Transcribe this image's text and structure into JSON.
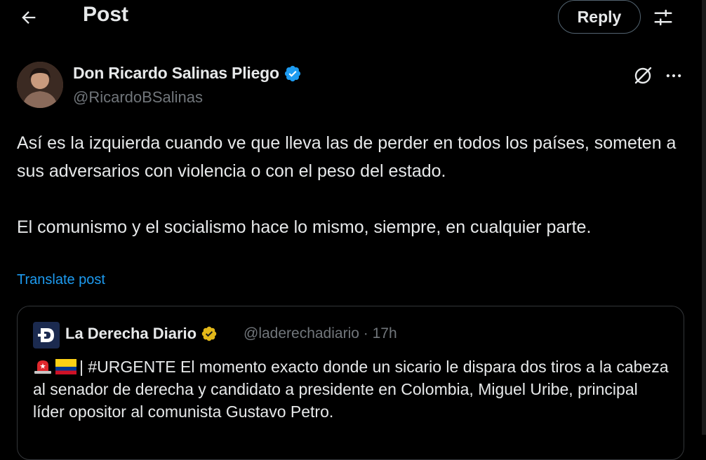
{
  "header": {
    "title": "Post",
    "reply_label": "Reply"
  },
  "post": {
    "author_name": "Don Ricardo Salinas Pliego",
    "author_handle": "@RicardoBSalinas",
    "paragraph1": "Así es la izquierda cuando ve que lleva las de perder en todos los países, someten a sus adversarios con violencia o con el peso del estado.",
    "paragraph2": "El comunismo y el socialismo hace lo mismo, siempre, en cualquier parte.",
    "translate_label": "Translate post"
  },
  "quote": {
    "author_name": "La Derecha Diario",
    "author_handle": "@laderechadiario",
    "time": "· 17h",
    "text": "| #URGENTE El momento exacto donde un sicario le dispara dos tiros a la cabeza al senador de derecha y candidato a presidente en Colombia, Miguel Uribe, principal líder opositor al comunista Gustavo Petro."
  },
  "colors": {
    "background": "#000000",
    "text": "#e7e9ea",
    "secondary": "#71767b",
    "link": "#1d9bf0",
    "verified_blue": "#1d9bf0",
    "verified_gold": "#e2b719"
  },
  "icons": [
    "back-arrow-icon",
    "adjust-icon",
    "verified-badge-icon",
    "grok-icon",
    "more-icon",
    "gold-verified-badge-icon",
    "siren-emoji-icon",
    "colombia-flag-icon"
  ]
}
